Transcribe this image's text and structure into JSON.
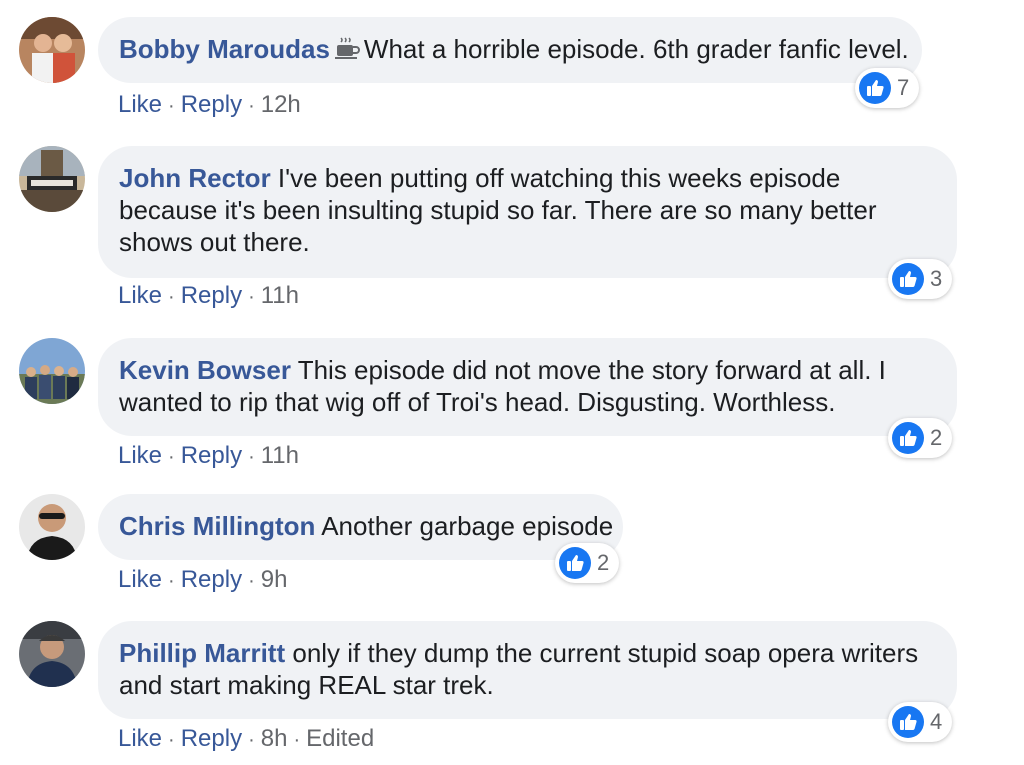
{
  "comments": [
    {
      "author": "Bobby Maroudas",
      "text": "What a horrible episode. 6th grader fanfic level.",
      "badge_icon": "coffee-cup-icon",
      "actions": {
        "like": "Like",
        "reply": "Reply",
        "time": "12h",
        "edited": ""
      },
      "reactions": {
        "icon": "thumbs-up-icon",
        "count": "7"
      }
    },
    {
      "author": "John Rector",
      "text": "I've been putting off watching this weeks episode because it's been insulting stupid so far. There are so many better shows out there.",
      "actions": {
        "like": "Like",
        "reply": "Reply",
        "time": "11h",
        "edited": ""
      },
      "reactions": {
        "icon": "thumbs-up-icon",
        "count": "3"
      }
    },
    {
      "author": "Kevin Bowser",
      "text": "This episode did not move the story forward at all. I wanted to rip that wig off of Troi's head. Disgusting. Worthless.",
      "actions": {
        "like": "Like",
        "reply": "Reply",
        "time": "11h",
        "edited": ""
      },
      "reactions": {
        "icon": "thumbs-up-icon",
        "count": "2"
      }
    },
    {
      "author": "Chris Millington",
      "text": "Another garbage episode",
      "actions": {
        "like": "Like",
        "reply": "Reply",
        "time": "9h",
        "edited": ""
      },
      "reactions": {
        "icon": "thumbs-up-icon",
        "count": "2"
      }
    },
    {
      "author": "Phillip Marritt",
      "text": "only if they dump the current stupid soap opera writers and start making REAL star trek.",
      "actions": {
        "like": "Like",
        "reply": "Reply",
        "time": "8h",
        "edited": "Edited"
      },
      "reactions": {
        "icon": "thumbs-up-icon",
        "count": "4"
      }
    }
  ],
  "colors": {
    "author": "#385898",
    "bubble": "#f0f2f5",
    "meta": "#65676b",
    "like_badge": "#1877f2"
  }
}
